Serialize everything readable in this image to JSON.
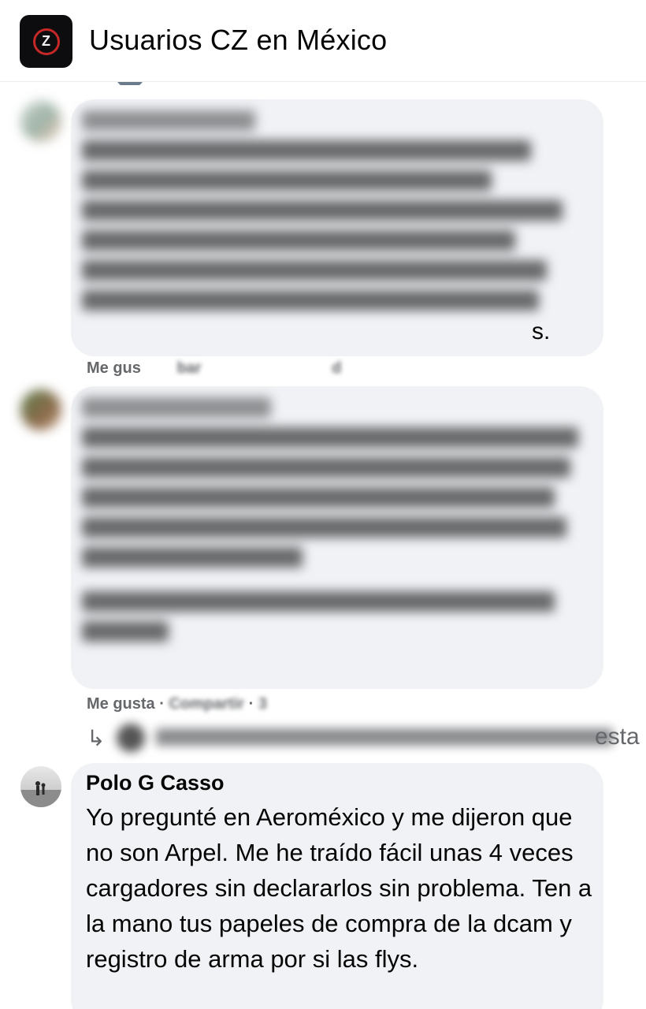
{
  "header": {
    "group_title": "Usuarios CZ en México",
    "group_icon_letter": "Z"
  },
  "comments": [
    {
      "author_visible": false,
      "text_visible_tail": "s.",
      "actions": {
        "like": "Me gus",
        "share": "bar",
        "reply": "d"
      }
    },
    {
      "author_visible": false,
      "actions": {
        "like": "Me gusta",
        "share": "Compartir",
        "time": "3"
      }
    }
  ],
  "reply_link": {
    "tail": "esta"
  },
  "featured_comment": {
    "author": "Polo G Casso",
    "text": "Yo pregunté en Aeroméxico y me dijeron que no son Arpel. Me he traído fácil unas 4 veces cargadores sin declararlos sin problema. Ten a la mano tus papeles de compra de la dcam y registro de arma por si las flys."
  },
  "colors": {
    "bubble_bg": "#f0f2f5",
    "meta_text": "#65676b",
    "body_text": "#050505",
    "brand_ring": "#c62828"
  }
}
